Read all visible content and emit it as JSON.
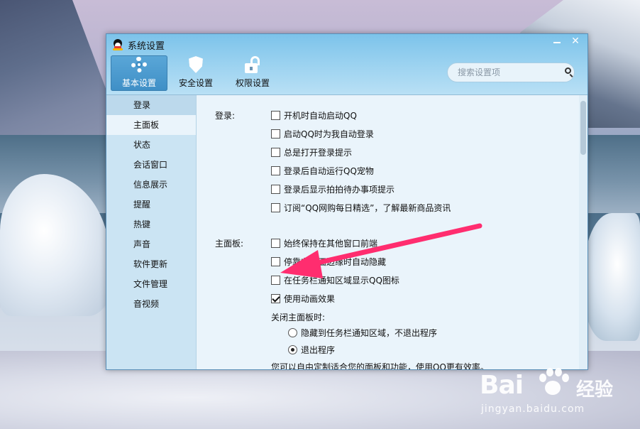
{
  "window": {
    "title": "系统设置",
    "minimize_label": "",
    "close_label": "✕"
  },
  "toolbar": {
    "tabs": [
      {
        "label": "基本设置",
        "icon": "gear-icon",
        "active": true
      },
      {
        "label": "安全设置",
        "icon": "shield-icon",
        "active": false
      },
      {
        "label": "权限设置",
        "icon": "unlock-icon",
        "active": false
      }
    ]
  },
  "search": {
    "placeholder": "搜索设置项"
  },
  "sidebar": {
    "items": [
      {
        "label": "登录"
      },
      {
        "label": "主面板"
      },
      {
        "label": "状态"
      },
      {
        "label": "会话窗口"
      },
      {
        "label": "信息展示"
      },
      {
        "label": "提醒"
      },
      {
        "label": "热键"
      },
      {
        "label": "声音"
      },
      {
        "label": "软件更新"
      },
      {
        "label": "文件管理"
      },
      {
        "label": "音视频"
      }
    ]
  },
  "login_section": {
    "label": "登录:",
    "options": [
      {
        "label": "开机时自动启动QQ",
        "checked": false
      },
      {
        "label": "启动QQ时为我自动登录",
        "checked": false
      },
      {
        "label": "总是打开登录提示",
        "checked": false
      },
      {
        "label": "登录后自动运行QQ宠物",
        "checked": false
      },
      {
        "label": "登录后显示拍拍待办事项提示",
        "checked": false
      },
      {
        "label": "订阅“QQ网购每日精选”，了解最新商品资讯",
        "checked": false
      }
    ]
  },
  "panel_section": {
    "label": "主面板:",
    "options": [
      {
        "label": "始终保持在其他窗口前端",
        "checked": false
      },
      {
        "label": "停靠在桌面边缘时自动隐藏",
        "checked": false
      },
      {
        "label": "在任务栏通知区域显示QQ图标",
        "checked": false
      },
      {
        "label": "使用动画效果",
        "checked": true
      }
    ],
    "close_label": "关闭主面板时:",
    "close_options": [
      {
        "label": "隐藏到任务栏通知区域，不退出程序",
        "selected": false
      },
      {
        "label": "退出程序",
        "selected": true
      }
    ],
    "footer_text": "您可以自由定制适合您的面板和功能，使用QQ更有效率。"
  },
  "annotation": {
    "arrow_color": "#ff2d6f"
  },
  "watermark": {
    "brand_left": "Bai",
    "brand_right": "经验",
    "url": "jingyan.baidu.com"
  }
}
